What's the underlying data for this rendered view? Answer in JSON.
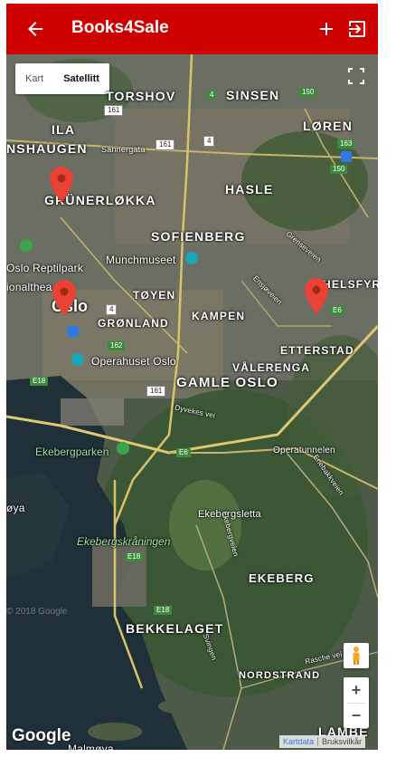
{
  "appbar": {
    "title": "Books4Sale",
    "back_icon": "arrow-back-icon",
    "add_icon": "plus-icon",
    "logout_icon": "exit-to-app-icon",
    "color": "#cc0000"
  },
  "map_controls": {
    "map_type": [
      "Kart",
      "Satellitt"
    ],
    "selected_map_type": "Satellitt",
    "fullscreen_icon": "fullscreen-icon",
    "pegman_icon": "street-view-pegman-icon",
    "zoom_in": "+",
    "zoom_out": "−"
  },
  "map_labels": {
    "torshov": "TORSHOV",
    "sinsen": "SINSEN",
    "loren": "LØREN",
    "nshaugen": "NSHAUGEN",
    "ila": "ILA",
    "grunerlokka": "GRÜNERLØKKA",
    "hasle": "HASLE",
    "sofienberg": "SOFIENBERG",
    "munchmuseet": "Munchmuseet",
    "oslo_reptilpark": "Oslo Reptilpark",
    "ionalthea": "ionalthea",
    "oslo": "Oslo",
    "toyen": "TØYEN",
    "helsfyr": "HELSFYR",
    "gronland": "GRØNLAND",
    "kampen": "KAMPEN",
    "etterstad": "ETTERSTAD",
    "operahuset": "Operahuset Oslo",
    "valerenga": "VÅLERENGA",
    "gamle_oslo": "GAMLE OSLO",
    "dyvekes_vei": "Dyvekes vei",
    "ekebergparken": "Ekebergparken",
    "operatunnelen": "Operatunnelen",
    "oya": "øya",
    "ekebergsletta": "Ekebergsletta",
    "ekebergskraningen": "Ekebergskråningen",
    "ekeberg": "EKEBERG",
    "bekkelaget": "BEKKELAGET",
    "nordstrand": "NORDSTRAND",
    "lambe": "LAMBE",
    "malmoya": "Malmøya",
    "sannergata": "Sannergata",
    "ensjoveien": "Ensjøveien",
    "enebakkveien": "Enebakkveien",
    "rasche_vei": "Rasche vei",
    "svingen": "Svingen",
    "grensevelen": "Grenseveien",
    "ekebergveien": "Ekebergveien"
  },
  "road_badges": {
    "r161a": "161",
    "r161b": "161",
    "r161c": "161",
    "r4a": "4",
    "r4b": "4",
    "r4c": "4",
    "r150a": "150",
    "r150b": "150",
    "r163": "163",
    "r162": "162",
    "e18a": "E18",
    "e18b": "E18",
    "e18c": "E18",
    "e6a": "E6",
    "e6b": "E6"
  },
  "attribution": {
    "google": "Google",
    "copyright": "© 2018 Google",
    "map_data": "Kartdata",
    "terms": "Bruksvilkår"
  }
}
